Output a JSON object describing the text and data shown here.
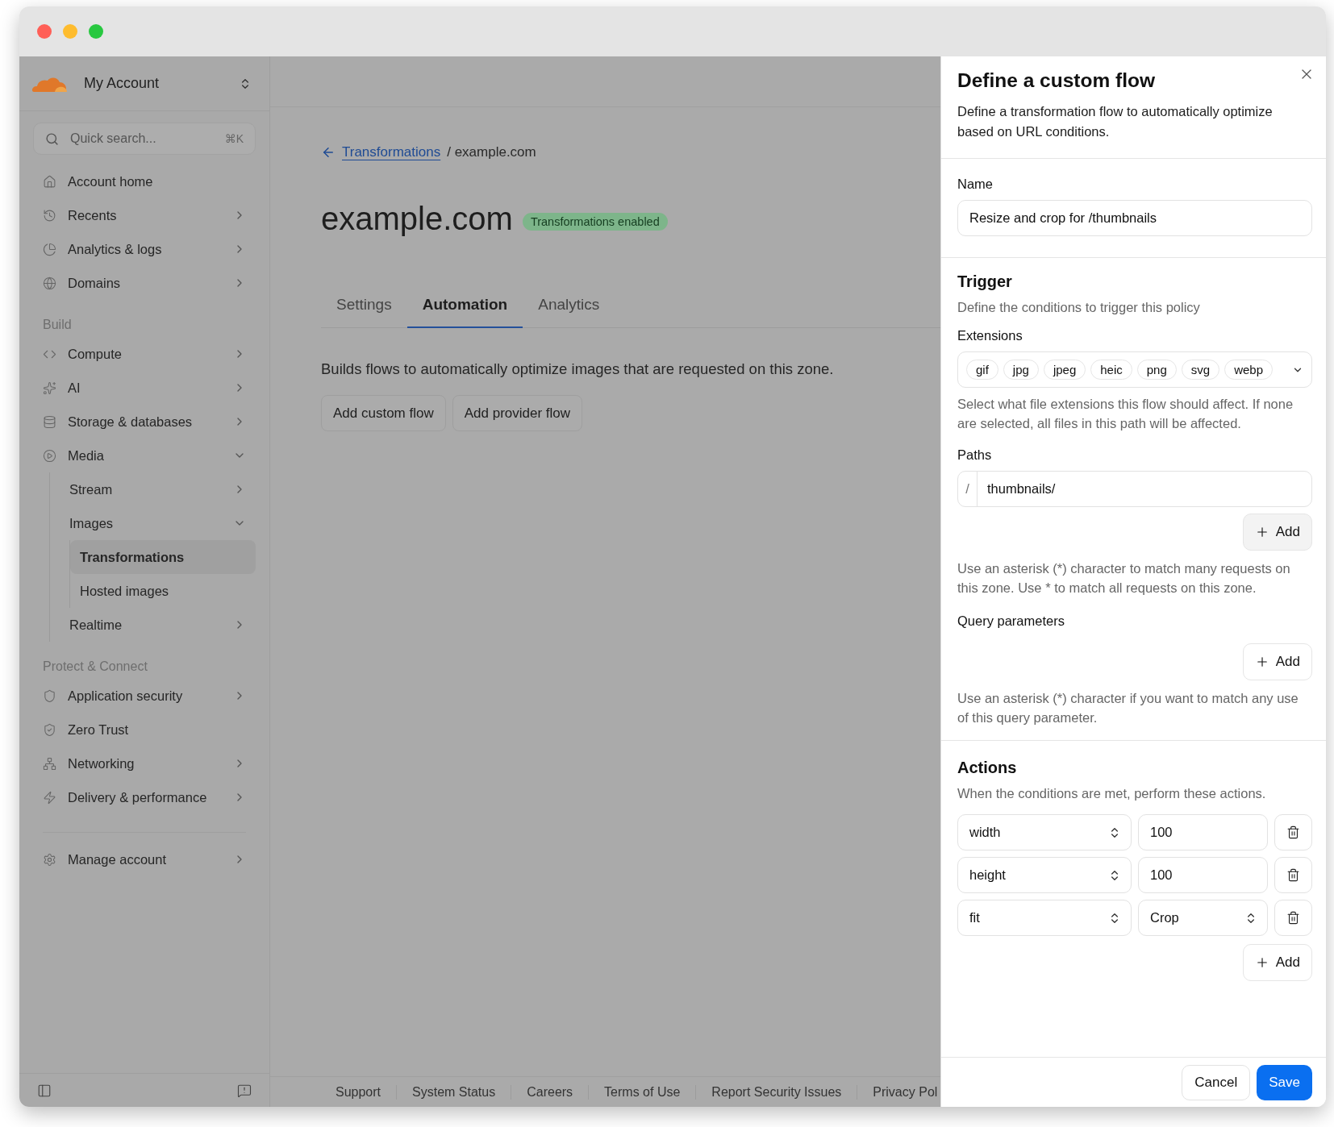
{
  "sidebar": {
    "account": {
      "name": "My Account"
    },
    "search": {
      "placeholder": "Quick search...",
      "shortcut": "⌘K"
    },
    "sections": [
      {
        "items": [
          {
            "label": "Account home"
          },
          {
            "label": "Recents",
            "expanded": false
          },
          {
            "label": "Analytics & logs",
            "expanded": false
          },
          {
            "label": "Domains",
            "expanded": false
          }
        ]
      },
      {
        "heading": "Build",
        "items": [
          {
            "label": "Compute",
            "expanded": false
          },
          {
            "label": "AI",
            "expanded": false
          },
          {
            "label": "Storage & databases",
            "expanded": false
          },
          {
            "label": "Media",
            "expanded": true,
            "children": [
              {
                "label": "Stream",
                "expanded": false
              },
              {
                "label": "Images",
                "expanded": true,
                "children": [
                  {
                    "label": "Transformations",
                    "selected": true
                  },
                  {
                    "label": "Hosted images",
                    "selected": false
                  }
                ]
              },
              {
                "label": "Realtime",
                "expanded": false
              }
            ]
          }
        ]
      },
      {
        "heading": "Protect & Connect",
        "items": [
          {
            "label": "Application security",
            "expanded": false
          },
          {
            "label": "Zero Trust"
          },
          {
            "label": "Networking",
            "expanded": false
          },
          {
            "label": "Delivery & performance",
            "expanded": false
          }
        ]
      },
      {
        "items": [
          {
            "label": "Manage account",
            "expanded": false
          }
        ]
      }
    ]
  },
  "main": {
    "breadcrumb": {
      "link": "Transformations",
      "current": "/ example.com"
    },
    "title": "example.com",
    "badge": "Transformations enabled",
    "tabs": [
      {
        "label": "Settings",
        "selected": false
      },
      {
        "label": "Automation",
        "selected": true
      },
      {
        "label": "Analytics",
        "selected": false
      }
    ],
    "description": "Builds flows to automatically optimize images that are requested on this zone.",
    "buttons": [
      "Add custom flow",
      "Add provider flow"
    ]
  },
  "footer": [
    "Support",
    "System Status",
    "Careers",
    "Terms of Use",
    "Report Security Issues",
    "Privacy Pol"
  ],
  "panel": {
    "title": "Define a custom flow",
    "description": "Define a transformation flow to automatically optimize based on URL conditions.",
    "name": {
      "label": "Name",
      "value": "Resize and crop for /thumbnails"
    },
    "trigger": {
      "title": "Trigger",
      "description": "Define the conditions to trigger this policy",
      "extensions": {
        "label": "Extensions",
        "chips": [
          "gif",
          "jpg",
          "jpeg",
          "heic",
          "png",
          "svg",
          "webp"
        ],
        "help": "Select what file extensions this flow should affect. If none are selected, all files in this path will be affected."
      },
      "paths": {
        "label": "Paths",
        "prefix": "/",
        "value": "thumbnails/",
        "add": "Add",
        "help": "Use an asterisk (*) character to match many requests on this zone. Use * to match all requests on this zone."
      },
      "query": {
        "label": "Query parameters",
        "add": "Add",
        "help": "Use an asterisk (*) character if you want to match any use of this query parameter."
      }
    },
    "actions": {
      "title": "Actions",
      "description": "When the conditions are met, perform these actions.",
      "rows": [
        {
          "key": "width",
          "value": "100",
          "kind": "input"
        },
        {
          "key": "height",
          "value": "100",
          "kind": "input"
        },
        {
          "key": "fit",
          "value": "Crop",
          "kind": "select"
        }
      ],
      "add": "Add"
    },
    "cancel": "Cancel",
    "save": "Save"
  }
}
